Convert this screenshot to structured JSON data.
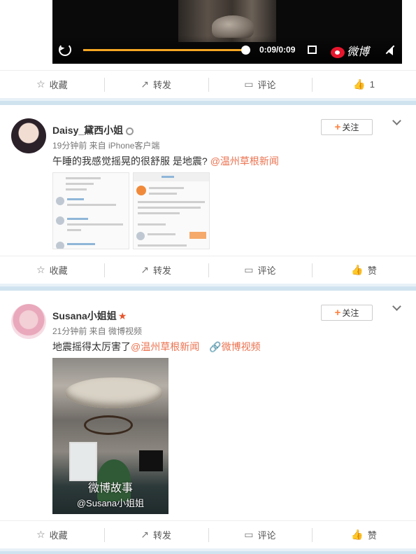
{
  "top_video": {
    "time": "0:09/0:09",
    "brand": "微博",
    "progress_fraction": 1.0
  },
  "post0_actions": {
    "favorite": "收藏",
    "repost": "转发",
    "comment": "评论",
    "like": "1"
  },
  "posts": [
    {
      "user": "Daisy_黛西小姐",
      "meta": "19分钟前 来自 iPhone客户端",
      "text": "午睡的我感觉摇晃的很舒服  是地震?",
      "mention": "@温州草根新闻",
      "follow": "关注",
      "actions": {
        "favorite": "收藏",
        "repost": "转发",
        "comment": "评论",
        "like": "赞"
      }
    },
    {
      "user": "Susana小姐姐",
      "meta": "21分钟前 来自 微博视频",
      "text": "地震摇得太厉害了",
      "mention": "@温州草根新闻",
      "link": "微博视频",
      "follow": "关注",
      "video_caption": "微博故事",
      "video_watermark": "@Susana小姐姐",
      "actions": {
        "favorite": "收藏",
        "repost": "转发",
        "comment": "评论",
        "like": "赞"
      }
    }
  ],
  "colors": {
    "accent_orange": "#eb7350",
    "progress": "#f5a623",
    "divider": "#cfe3ef"
  }
}
